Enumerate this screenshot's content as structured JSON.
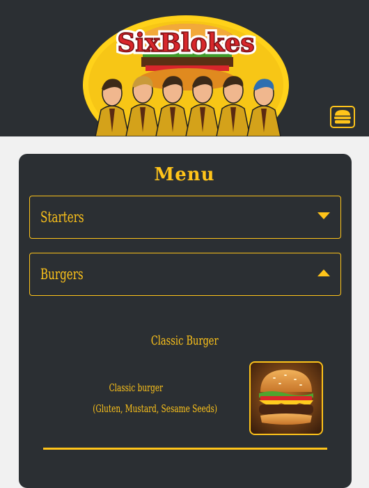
{
  "header": {
    "logo_text": "SixBlokes",
    "nav_toggle_icon": "burger-menu-icon"
  },
  "menu": {
    "title": "Menu",
    "sections": [
      {
        "label": "Starters",
        "state": "collapsed",
        "icon": "caret-down-icon"
      },
      {
        "label": "Burgers",
        "state": "expanded",
        "icon": "caret-up-icon"
      }
    ],
    "item": {
      "name": "Classic Burger",
      "description": "Classic burger",
      "allergens": "(Gluten, Mustard, Sesame Seeds)",
      "image": "burger-photo"
    }
  },
  "colors": {
    "accent": "#ffc41a",
    "panel": "#2b2f33",
    "page_bg": "#f1f1f1",
    "logo_red": "#d8262b"
  }
}
